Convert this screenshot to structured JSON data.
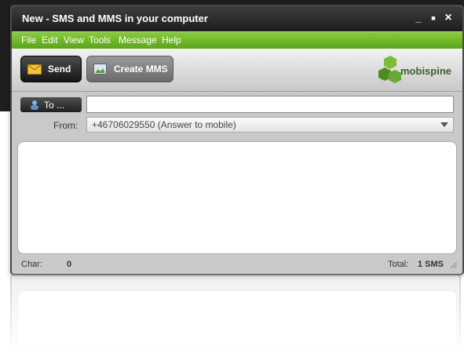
{
  "window": {
    "title": "New - SMS and MMS in your computer"
  },
  "window_controls": {
    "minimize": "_",
    "maximize": "■",
    "close": "×"
  },
  "menu": [
    "File",
    "Edit",
    "View",
    "Tools",
    "Message",
    "Help"
  ],
  "toolbar": {
    "send_label": "Send",
    "create_mms_label": "Create MMS"
  },
  "logo": {
    "text": "mobispine"
  },
  "compose": {
    "to_button_label": "To ...",
    "to_value": "",
    "from_label": "From:",
    "from_value": "+46706029550 (Answer to mobile)",
    "message_text": ""
  },
  "status": {
    "char_label": "Char:",
    "char_count": "0",
    "total_label": "Total:",
    "total_value": "1 SMS"
  },
  "colors": {
    "menubar": "#6cb52a",
    "titlebar": "#2b2b2b",
    "logo_green": "#5e9e2a"
  }
}
